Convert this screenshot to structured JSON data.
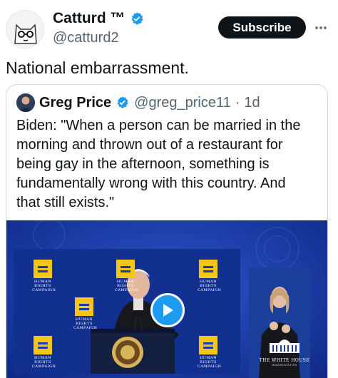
{
  "author": {
    "display_name": "Catturd ™",
    "handle": "@catturd2",
    "verified_icon": "verified-badge-icon",
    "avatar_icon": "cat-avatar-icon"
  },
  "subscribe_label": "Subscribe",
  "more_icon": "more-options-icon",
  "tweet_text": "National embarrassment.",
  "quoted": {
    "display_name": "Greg Price",
    "handle": "@greg_price11",
    "separator": "·",
    "time": "1d",
    "line_1": "Biden: \"When a person can be married in the",
    "line_2": "morning and thrown out of a restaurant for",
    "line_3": "being gay in the afternoon, something is",
    "line_4": "fundamentally wrong with this country. And",
    "line_5": "that still exists.\""
  },
  "media": {
    "play_icon": "play-icon",
    "sign_caption": "HUMAN RIGHTS CAMPAIGN",
    "white_house_label": "THE WHITE HOUSE",
    "white_house_sublabel": "WASHINGTON"
  },
  "colors": {
    "accent": "#1d9bf0",
    "text": "#0f1419",
    "muted": "#536471",
    "video_bg": "#1a3aa8",
    "sign_yellow": "#f5c518"
  }
}
